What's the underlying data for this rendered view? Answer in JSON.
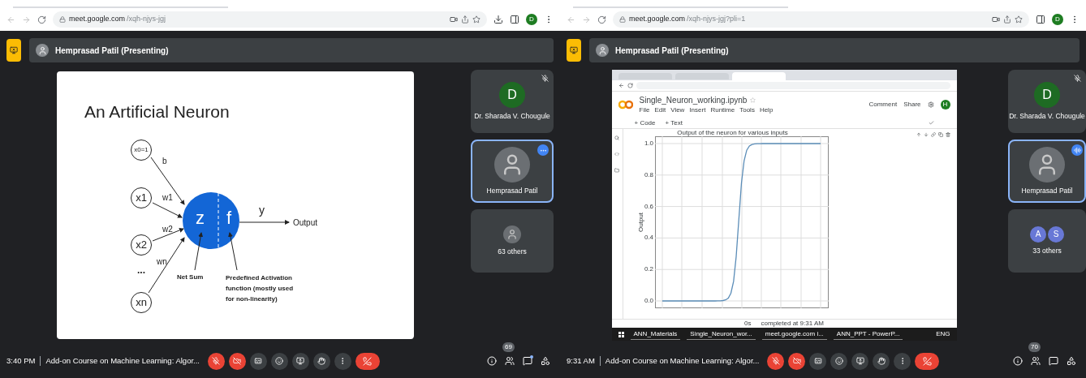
{
  "panels": [
    {
      "browser": {
        "url_host": "meet.google.com",
        "url_path": "/xqh-njys-jgj",
        "profile_initial": "D",
        "download_icon": true
      },
      "presenter_name": "Hemprasad Patil (Presenting)",
      "stage": {
        "kind": "slide",
        "title": "An Artificial Neuron",
        "inputs": [
          "x0=1",
          "x1",
          "x2",
          "...",
          "xn"
        ],
        "weights": [
          "b",
          "w1",
          "w2",
          "wn"
        ],
        "sum_symbol": "z",
        "activation_symbol": "f",
        "output_symbol": "y",
        "output_label": "Output",
        "sum_label": "Net Sum",
        "activation_label": "Predefined Activation function (mostly used for non-linearity)"
      },
      "tiles": [
        {
          "kind": "avatar",
          "name": "Dr. Sharada V. Chougule",
          "initial": "D",
          "color": "#1e6b23",
          "muted": true,
          "selected": false
        },
        {
          "kind": "video",
          "name": "Hemprasad Patil",
          "badge": {
            "kind": "more"
          },
          "selected": true
        },
        {
          "kind": "others",
          "label": "63 others",
          "avatars": [
            {
              "kind": "photo"
            }
          ]
        }
      ],
      "bottom": {
        "time": "3:40 PM",
        "meeting_title": "Add-on Course on Machine Learning: Algor...",
        "mic_on": false,
        "camera_on": false,
        "participant_count": "69",
        "chat_unread": true
      }
    },
    {
      "browser": {
        "url_host": "meet.google.com",
        "url_path": "/xqh-njys-jgj?pli=1",
        "profile_initial": "D",
        "download_icon": false
      },
      "presenter_name": "Hemprasad Patil (Presenting)",
      "stage": {
        "kind": "screen",
        "tabs": [
          {
            "selected": false
          },
          {
            "selected": false
          },
          {
            "selected": true
          }
        ],
        "file_name": "Single_Neuron_working.ipynb",
        "menu": [
          "File",
          "Edit",
          "View",
          "Insert",
          "Runtime",
          "Tools",
          "Help"
        ],
        "comment": "Comment",
        "share": "Share",
        "profile_initial": "H",
        "add_code": "+ Code",
        "add_text": "+ Text",
        "chart_title": "Output of the neuron for various inputs",
        "y_label": "Output",
        "y_ticks": [
          "1.0",
          "0.8",
          "0.6",
          "0.4",
          "0.2",
          "0.0"
        ],
        "status_time": "0s",
        "status_text": "completed at 9:31 AM",
        "taskbar": [
          "ANN_Materials",
          "Single_Neuron_wor...",
          "meet.google.com i...",
          "ANN_PPT - PowerP..."
        ],
        "tray_language": "ENG"
      },
      "tiles": [
        {
          "kind": "avatar",
          "name": "Dr. Sharada V. Chougule",
          "initial": "D",
          "color": "#1e6b23",
          "muted": true,
          "selected": false
        },
        {
          "kind": "video",
          "name": "Hemprasad Patil",
          "badge": {
            "kind": "audio"
          },
          "selected": true
        },
        {
          "kind": "others",
          "label": "33 others",
          "avatars": [
            {
              "kind": "letter",
              "initial": "A",
              "color": "#6878d6"
            },
            {
              "kind": "letter",
              "initial": "S",
              "color": "#6878d6"
            }
          ]
        }
      ],
      "bottom": {
        "time": "9:31 AM",
        "meeting_title": "Add-on Course on Machine Learning: Algor...",
        "mic_on": false,
        "camera_on": false,
        "participant_count": "70",
        "chat_unread": false
      }
    }
  ]
}
